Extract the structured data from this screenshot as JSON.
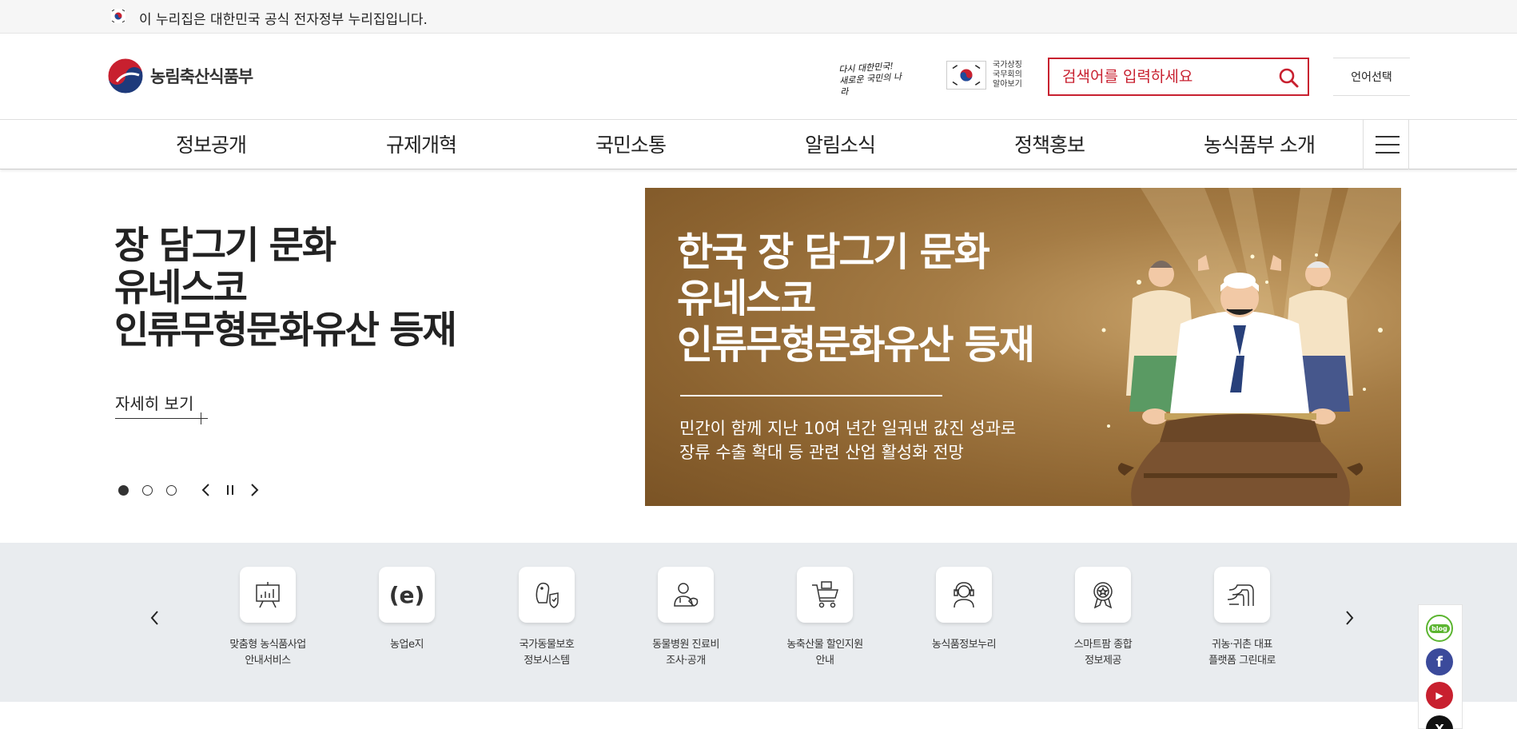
{
  "gov_banner": {
    "text": "이 누리집은 대한민국 공식 전자정부 누리집입니다."
  },
  "header": {
    "logo_text": "농림축산식품부",
    "slogan": "다시 대한민국! 새로운 국민의 나라",
    "symbols_label": "국가상징 국무회의 알아보기",
    "search_placeholder": "검색어를 입력하세요",
    "language_button": "언어선택"
  },
  "gnb": {
    "items": [
      "정보공개",
      "규제개혁",
      "국민소통",
      "알림소식",
      "정책홍보",
      "농식품부 소개"
    ]
  },
  "hero": {
    "title_lines": [
      "장 담그기 문화",
      "유네스코",
      "인류무형문화유산 등재"
    ],
    "more_link": "자세히 보기",
    "banner_title_lines": [
      "한국 장 담그기 문화",
      "유네스코",
      "인류무형문화유산 등재"
    ],
    "banner_desc_lines": [
      "민간이 함께 지난 10여 년간 일궈낸 값진 성과로",
      "장류 수출 확대 등 관련 산업 활성화 전망"
    ],
    "slide_count": 3,
    "active_slide": 1
  },
  "quick_menu": {
    "items": [
      {
        "icon": "presentation-board-icon",
        "label_lines": [
          "맞춤형 농식품사업",
          "안내서비스"
        ]
      },
      {
        "icon": "e-letter-icon",
        "label_lines": [
          "농업e지",
          ""
        ]
      },
      {
        "icon": "dog-shield-icon",
        "label_lines": [
          "국가동물보호",
          "정보시스템"
        ]
      },
      {
        "icon": "vet-doctor-icon",
        "label_lines": [
          "동물병원 진료비",
          "조사·공개"
        ]
      },
      {
        "icon": "shopping-cart-icon",
        "label_lines": [
          "농축산물 할인지원",
          "안내"
        ]
      },
      {
        "icon": "headset-agent-icon",
        "label_lines": [
          "농식품정보누리",
          ""
        ]
      },
      {
        "icon": "award-medal-icon",
        "label_lines": [
          "스마트팜 종합",
          "정보제공"
        ]
      },
      {
        "icon": "winding-road-icon",
        "label_lines": [
          "귀농·귀촌 대표",
          "플랫폼 그린대로"
        ]
      }
    ]
  },
  "sns": {
    "items": [
      {
        "name": "blog",
        "label": "blog",
        "color": "#5cb531"
      },
      {
        "name": "facebook",
        "label": "f",
        "color": "#3b4a9b"
      },
      {
        "name": "youtube",
        "label": "▶",
        "color": "#c8202f"
      },
      {
        "name": "x",
        "label": "X",
        "color": "#111111"
      }
    ]
  },
  "colors": {
    "accent": "#c8202f",
    "banner_brown": "#8c6330",
    "quick_bg": "#e9ecef"
  }
}
